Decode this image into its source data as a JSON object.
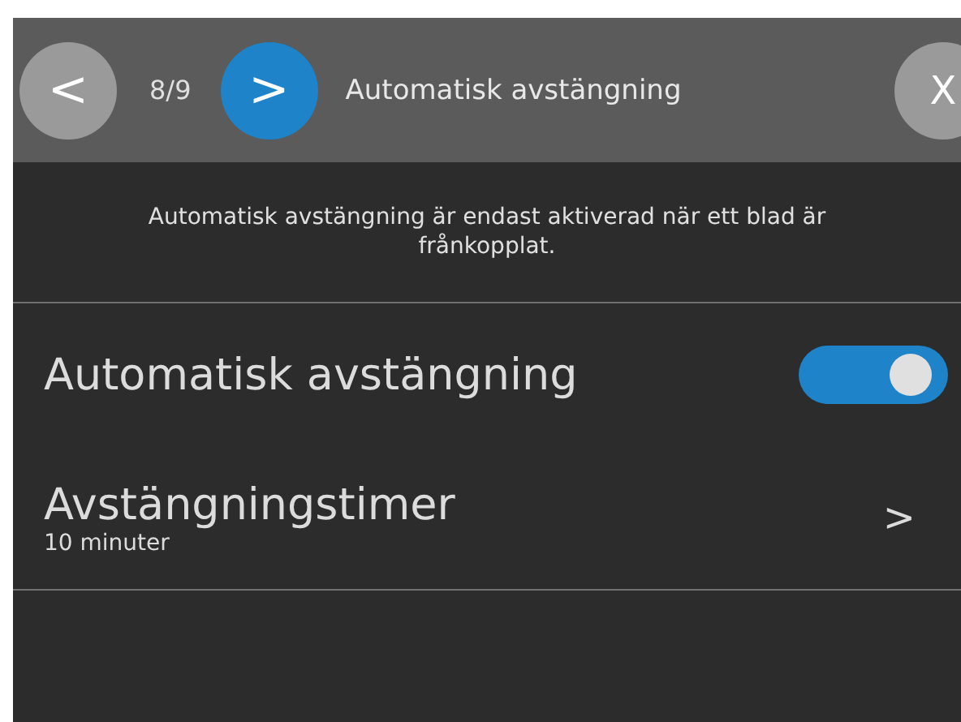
{
  "header": {
    "back_button": "<",
    "counter": "8/9",
    "next_button": ">",
    "title": "Automatisk avstängning",
    "close_button": "X"
  },
  "info": "Automatisk avstängning är endast aktiverad när ett blad är frånkopplat.",
  "settings": [
    {
      "kind": "toggle",
      "label": "Automatisk avstängning",
      "on": true
    },
    {
      "kind": "link",
      "label": "Avstängningstimer",
      "value": "10 minuter",
      "chevron": ">"
    }
  ]
}
